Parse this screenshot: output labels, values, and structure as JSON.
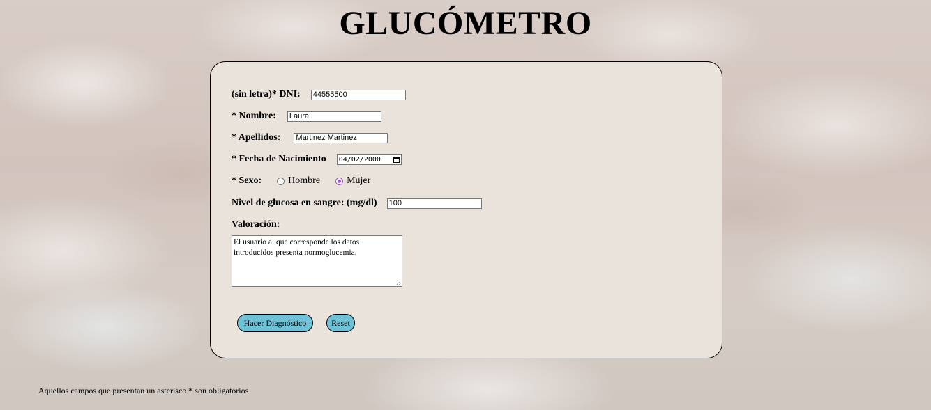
{
  "page": {
    "title": "GLUCÓMETRO",
    "footer_note": "Aquellos campos que presentan un asterisco * son obligatorios"
  },
  "form": {
    "dni": {
      "label": "(sin letra)* DNI:",
      "value": "44555500"
    },
    "nombre": {
      "label": "* Nombre:",
      "value": "Laura"
    },
    "apellidos": {
      "label": "* Apellidos:",
      "value": "Martinez Martinez"
    },
    "fecha_nacimiento": {
      "label": "* Fecha de Nacimiento",
      "value": "04/02/2000"
    },
    "sexo": {
      "label": "* Sexo:",
      "options": [
        {
          "label": "Hombre",
          "selected": false
        },
        {
          "label": "Mujer",
          "selected": true
        }
      ]
    },
    "glucosa": {
      "label": "Nivel de glucosa en sangre: (mg/dl)",
      "value": "100"
    },
    "valoracion": {
      "label": "Valoración:",
      "value": "El usuario al que corresponde los datos introducidos presenta normoglucemia."
    },
    "buttons": {
      "diagnostico": "Hacer Diagnóstico",
      "reset": "Reset"
    }
  },
  "colors": {
    "panel_background": "#e9e3dc",
    "button_background": "#6fc1d6",
    "radio_accent": "#a64fd6"
  }
}
